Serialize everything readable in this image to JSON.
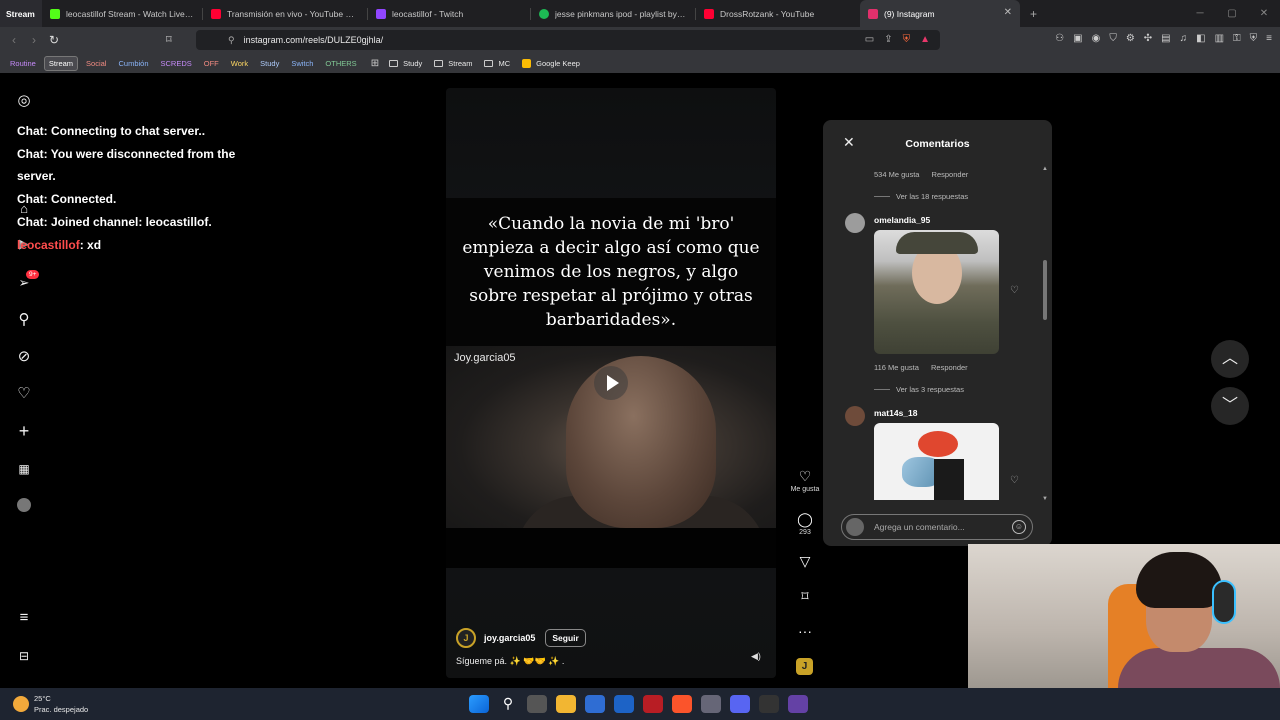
{
  "browser": {
    "tabs": [
      {
        "title": "Stream",
        "color": "#2b2b30",
        "kind": "first"
      },
      {
        "title": "leocastillof Stream - Watch Live on K",
        "color": "#53fc18"
      },
      {
        "title": "Transmisión en vivo - YouTube Studio",
        "color": "#ff0033"
      },
      {
        "title": "leocastillof - Twitch",
        "color": "#9146ff"
      },
      {
        "title": "jesse pinkmans ipod - playlist by jayd",
        "color": "#1db954"
      },
      {
        "title": "DrossRotzank - YouTube",
        "color": "#ff0033"
      },
      {
        "title": "(9) Instagram",
        "color": "#e1306c",
        "active": true
      }
    ],
    "url": "instagram.com/reels/DULZE0gjhla/"
  },
  "bookmarks": {
    "tags": [
      {
        "label": "Routine",
        "color": "#c58af9"
      },
      {
        "label": "Stream",
        "color": "#ffffff",
        "boxed": true
      },
      {
        "label": "Social",
        "color": "#f28b82"
      },
      {
        "label": "Cumbión",
        "color": "#8ab4f8"
      },
      {
        "label": "SCREDS",
        "color": "#c58af9"
      },
      {
        "label": "OFF",
        "color": "#f28b82"
      },
      {
        "label": "Work",
        "color": "#fdd663"
      },
      {
        "label": "Study",
        "color": "#aecbfa"
      },
      {
        "label": "Switch",
        "color": "#8ab4f8"
      },
      {
        "label": "OTHERS",
        "color": "#81c995"
      }
    ],
    "folders": [
      {
        "label": "Study"
      },
      {
        "label": "Stream"
      },
      {
        "label": "MC"
      }
    ],
    "keep": "Google Keep"
  },
  "sidebar": {
    "notification_count": "9+"
  },
  "chat_overlay": {
    "lines": [
      "Chat: Connecting to chat server..",
      "Chat: You were disconnected from the server.",
      "Chat: Connected.",
      "Chat: Joined channel: leocastillof."
    ],
    "user_msg": {
      "user": "leocastillof",
      "text": ": xd"
    }
  },
  "reel": {
    "caption_text": "«Cuando la novia de mi 'bro' empieza a decir algo así como que venimos de los negros, y algo sobre respetar al prójimo y otras barbaridades».",
    "watermark": "Joy.garcia05",
    "author": "joy.garcia05",
    "follow_label": "Seguir",
    "description": "Sígueme pá. ✨ 🤝🤝 ✨ ."
  },
  "actions": {
    "like_label": "Me gusta",
    "comment_count": "293"
  },
  "comments": {
    "title": "Comentarios",
    "first_meta": {
      "likes": "534 Me gusta",
      "reply": "Responder"
    },
    "first_replies": "Ver las 18 respuestas",
    "items": [
      {
        "user": "omelandia_95",
        "likes": "116 Me gusta",
        "reply": "Responder",
        "replies": "Ver las 3 respuestas"
      },
      {
        "user": "mat14s_18"
      }
    ],
    "input_placeholder": "Agrega un comentario..."
  },
  "weather": {
    "temp": "25°C",
    "desc": "Prac. despejado"
  }
}
